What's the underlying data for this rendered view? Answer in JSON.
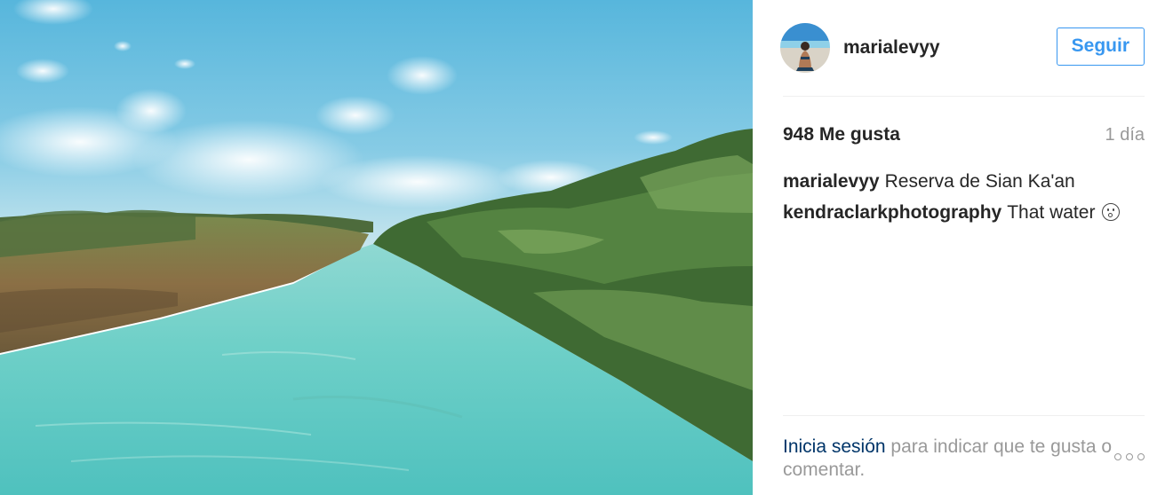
{
  "post": {
    "photo": {
      "alt": "Canal de agua turquesa entre manglares"
    },
    "author": {
      "username": "marialevyy"
    },
    "follow_label": "Seguir",
    "likes_text": "948 Me gusta",
    "time_text": "1 día",
    "comments": [
      {
        "author": "marialevyy",
        "text": "Reserva de Sian Ka'an",
        "emoji": null
      },
      {
        "author": "kendraclarkphotography",
        "text": "That water",
        "emoji": "astonished-face-icon"
      }
    ],
    "footer": {
      "login_link": "Inicia sesión",
      "login_prompt": " para indicar que te gusta o comentar."
    },
    "more_icon": "ellipsis-icon"
  },
  "colors": {
    "accent": "#3897f0",
    "link": "#003569",
    "muted": "#999999",
    "text": "#262626"
  }
}
